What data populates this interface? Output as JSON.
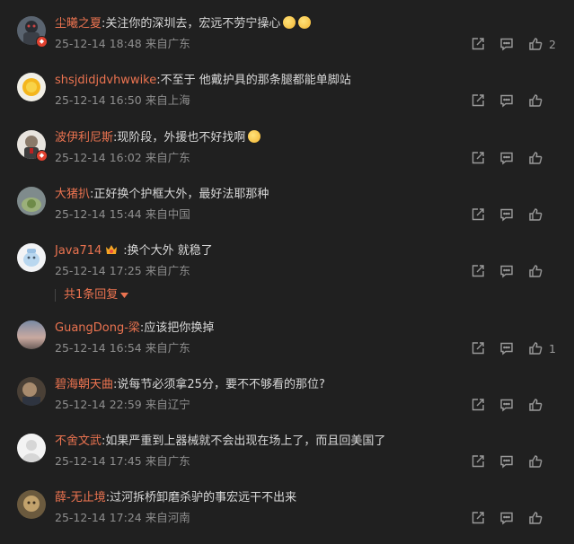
{
  "comments": [
    {
      "user": "尘曦之夏",
      "text": "关注你的深圳去，宏远不劳宁操心",
      "meta": "25-12-14 18:48 来自广东",
      "likes": "2",
      "emoji": 2,
      "badge": true
    },
    {
      "user": "shsjdidjdvhwwike",
      "text": "不至于 他戴护具的那条腿都能单脚站",
      "meta": "25-12-14 16:50 来自上海",
      "likes": "",
      "emoji": 0,
      "badge": false
    },
    {
      "user": "波伊利尼斯",
      "text": "现阶段，外援也不好找啊",
      "meta": "25-12-14 16:02 来自广东",
      "likes": "",
      "emoji": 1,
      "badge": true
    },
    {
      "user": "大猪扒",
      "text": "正好换个护框大外，最好法耶那种",
      "meta": "25-12-14 15:44 来自中国",
      "likes": "",
      "emoji": 0,
      "badge": false
    },
    {
      "user": "Java714",
      "text": ":换个大外 就稳了",
      "meta": "25-12-14 17:25 来自广东",
      "likes": "",
      "emoji": 0,
      "badge": false,
      "vip": true
    },
    {
      "user": "GuangDong-梁",
      "text": "应该把你换掉",
      "meta": "25-12-14 16:54 来自广东",
      "likes": "1",
      "emoji": 0,
      "badge": false
    },
    {
      "user": "碧海朝天曲",
      "text": "说每节必须拿25分，要不不够看的那位?",
      "meta": "25-12-14 22:59 来自辽宁",
      "likes": "",
      "emoji": 0,
      "badge": false
    },
    {
      "user": "不舍文武",
      "text": "如果严重到上器械就不会出现在场上了，而且回美国了",
      "meta": "25-12-14 17:45 来自广东",
      "likes": "",
      "emoji": 0,
      "badge": false
    },
    {
      "user": "薛-无止境",
      "text": "过河拆桥卸磨杀驴的事宏远干不出来",
      "meta": "25-12-14 17:24 来自河南",
      "likes": "",
      "emoji": 0,
      "badge": false
    }
  ],
  "replies_label": "共1条回复",
  "colors": {
    "background": "#202020",
    "username": "#eb7350",
    "text": "#d8d8d8",
    "meta": "#8e8e8e"
  },
  "icons": [
    "forward-icon",
    "comment-icon",
    "like-icon",
    "chevron-down-icon",
    "emoji-icon",
    "vip-icon"
  ]
}
